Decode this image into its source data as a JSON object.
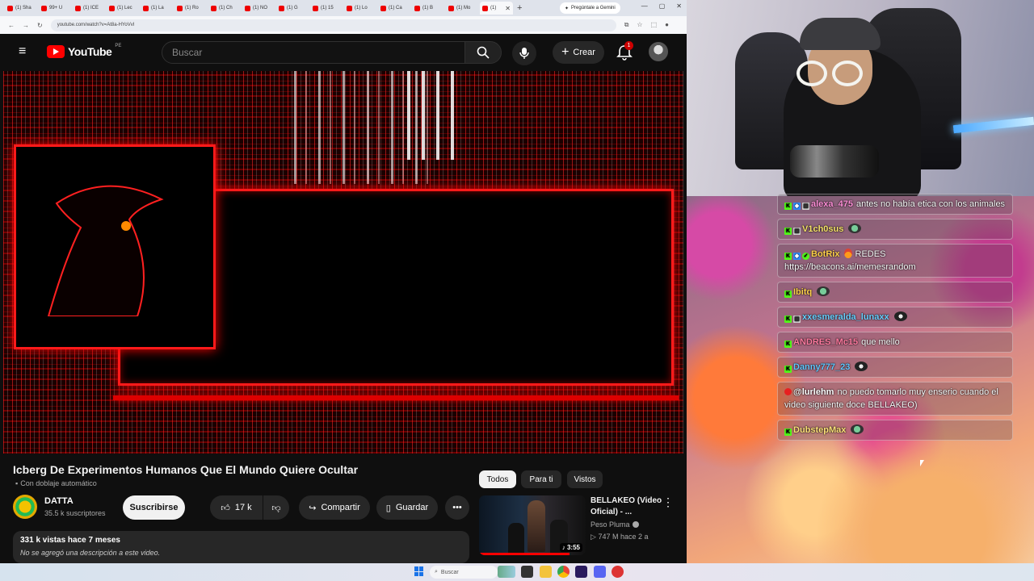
{
  "browser": {
    "tabs": [
      {
        "label": "(1) Sha"
      },
      {
        "label": "99+ U"
      },
      {
        "label": "(1) ICE"
      },
      {
        "label": "(1) Lec"
      },
      {
        "label": "(1) La"
      },
      {
        "label": "(1) Ro"
      },
      {
        "label": "(1) Ch"
      },
      {
        "label": "(1) NO"
      },
      {
        "label": "(1) G"
      },
      {
        "label": "(1) 15"
      },
      {
        "label": "(1) Lo"
      },
      {
        "label": "(1) Ca"
      },
      {
        "label": "(1) B"
      },
      {
        "label": "(1) Mo"
      },
      {
        "label": "(1)"
      }
    ],
    "gemini_button": "Pregúntale a Gemini",
    "url": "youtube.com/watch?v=At8a-HYoVvI"
  },
  "youtube": {
    "logo_text": "YouTube",
    "region": "PE",
    "search_placeholder": "Buscar",
    "create_label": "Crear",
    "notifications_count": "1"
  },
  "video": {
    "title": "Icberg De Experimentos Humanos Que El Mundo Quiere Ocultar",
    "dub_label": "Con doblaje automático",
    "channel_name": "DATTA",
    "subscribers": "35.5 k suscriptores",
    "subscribe_label": "Suscribirse",
    "likes": "17 k",
    "share_label": "Compartir",
    "save_label": "Guardar",
    "views_and_date": "331 k vistas  hace 7 meses",
    "description": "No se agregó una descripción a este video."
  },
  "chips": [
    {
      "label": "Todos",
      "active": true
    },
    {
      "label": "Para ti",
      "active": false
    },
    {
      "label": "Vistos",
      "active": false
    }
  ],
  "recommended": {
    "title": "BELLAKEO (Video Oficial) - ...",
    "channel": "Peso Pluma",
    "meta": "747 M  hace 2 a",
    "duration": "3:55",
    "watched_fraction": 0.85
  },
  "taskbar": {
    "search_placeholder": "Buscar"
  },
  "chat": [
    {
      "user": "alexa_475",
      "color": "#ff8fd8",
      "text": "antes no había etica con los animales",
      "badges": [
        "kick",
        "sub",
        "gift"
      ]
    },
    {
      "user": "V1ch0sus",
      "color": "#f7e36b",
      "text": "",
      "badges": [
        "kick",
        "gift"
      ],
      "emote": "green"
    },
    {
      "user": "BotRix",
      "color": "#ffd24a",
      "text": "REDES https://beacons.ai/memesrandom",
      "badges": [
        "kick",
        "sub",
        "check"
      ],
      "emote_before": "fire"
    },
    {
      "user": "Ibitq",
      "color": "#ffd24a",
      "text": "",
      "badges": [
        "kick"
      ],
      "emote": "green"
    },
    {
      "user": "xxesmeralda_lunaxx",
      "color": "#6ad0ff",
      "text": "",
      "badges": [
        "kick",
        "gift"
      ],
      "emote": "dark"
    },
    {
      "user": "ANDRES_Mc15",
      "color": "#ff7aa0",
      "text": "que mello",
      "badges": [
        "kick"
      ]
    },
    {
      "user": "Danny777_23",
      "color": "#64c8ff",
      "text": "",
      "badges": [
        "kick"
      ],
      "emote": "dark"
    },
    {
      "user": "@lurlehm",
      "color": "#ffffff",
      "text": "no puedo tomarlo muy enserio cuando el video siguiente doce BELLAKEO)",
      "badges": [
        "red"
      ]
    },
    {
      "user": "DubstepMax",
      "color": "#ffe27a",
      "text": "",
      "badges": [
        "kick"
      ],
      "emote": "green"
    }
  ]
}
